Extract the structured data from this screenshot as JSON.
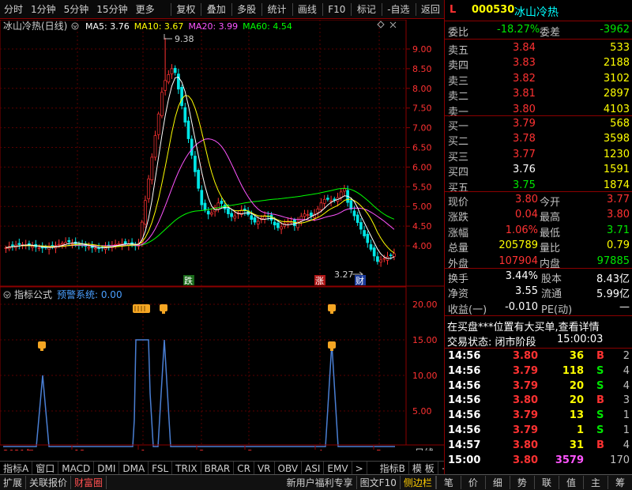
{
  "toolbar": {
    "left": [
      "分时",
      "1分钟",
      "5分钟",
      "15分钟",
      "更多"
    ],
    "right": [
      "复权",
      "叠加",
      "多股",
      "统计",
      "画线",
      "F10",
      "标记",
      "-自选",
      "返回"
    ]
  },
  "main_chart": {
    "title": "冰山冷热(日线)",
    "ma": [
      {
        "label": "MA5: 3.76",
        "color": "#ffffff"
      },
      {
        "label": "MA10: 3.67",
        "color": "#ffff00"
      },
      {
        "label": "MA20: 3.99",
        "color": "#ff55ff"
      },
      {
        "label": "MA60: 4.54",
        "color": "#00ff00"
      }
    ],
    "high_label": "9.38",
    "low_label": "3.27",
    "markers": [
      "跌",
      "涨",
      "财"
    ],
    "y_ticks": [
      "9.00",
      "8.50",
      "8.00",
      "7.50",
      "7.00",
      "6.50",
      "6.00",
      "5.50",
      "5.00",
      "4.50",
      "4.00"
    ]
  },
  "indicator_chart": {
    "title": "指标公式",
    "subtitle": "预警系统: 0.00",
    "y_ticks": [
      "20.00",
      "15.00",
      "10.00",
      "5.00"
    ]
  },
  "x_axis": {
    "labels": [
      "2021年",
      "12",
      "1",
      "2",
      "3",
      "4",
      "5"
    ],
    "period": "日线"
  },
  "bottom_tabs": [
    "指标A",
    "窗口",
    "MACD",
    "DMI",
    "DMA",
    "FSL",
    "TRIX",
    "BRAR",
    "CR",
    "VR",
    "OBV",
    "ASI",
    "EMV",
    ">",
    "指标B",
    "模 板",
    "+",
    "—"
  ],
  "stock": {
    "marker": "L",
    "code": "000530",
    "name": "冰山冷热"
  },
  "weibi": {
    "label1": "委比",
    "value1": "-18.27%",
    "label2": "委差",
    "value2": "-3962"
  },
  "asks": [
    {
      "label": "卖五",
      "price": "3.84",
      "vol": "533"
    },
    {
      "label": "卖四",
      "price": "3.83",
      "vol": "2188"
    },
    {
      "label": "卖三",
      "price": "3.82",
      "vol": "3102"
    },
    {
      "label": "卖二",
      "price": "3.81",
      "vol": "2897"
    },
    {
      "label": "卖一",
      "price": "3.80",
      "vol": "4103"
    }
  ],
  "bids": [
    {
      "label": "买一",
      "price": "3.79",
      "vol": "568",
      "pc": "red"
    },
    {
      "label": "买二",
      "price": "3.78",
      "vol": "3598",
      "pc": "red"
    },
    {
      "label": "买三",
      "price": "3.77",
      "vol": "1230",
      "pc": "red"
    },
    {
      "label": "买四",
      "price": "3.76",
      "vol": "1591",
      "pc": "white"
    },
    {
      "label": "买五",
      "price": "3.75",
      "vol": "1874",
      "pc": "green"
    }
  ],
  "quote": [
    {
      "l1": "现价",
      "v1": "3.80",
      "c1": "red",
      "l2": "今开",
      "v2": "3.77",
      "c2": "red"
    },
    {
      "l1": "涨跌",
      "v1": "0.04",
      "c1": "red",
      "l2": "最高",
      "v2": "3.80",
      "c2": "red"
    },
    {
      "l1": "涨幅",
      "v1": "1.06%",
      "c1": "red",
      "l2": "最低",
      "v2": "3.71",
      "c2": "green"
    },
    {
      "l1": "总量",
      "v1": "205789",
      "c1": "yellow",
      "l2": "量比",
      "v2": "0.79",
      "c2": "yellow"
    },
    {
      "l1": "外盘",
      "v1": "107904",
      "c1": "red",
      "l2": "内盘",
      "v2": "97885",
      "c2": "green"
    }
  ],
  "fin": [
    {
      "l1": "换手",
      "v1": "3.44%",
      "l2": "股本",
      "v2": "8.43亿"
    },
    {
      "l1": "净资",
      "v1": "3.55",
      "l2": "流通",
      "v2": "5.99亿"
    },
    {
      "l1": "收益(一)",
      "v1": "-0.010",
      "l2": "PE(动)",
      "v2": "—"
    }
  ],
  "notice": "在买盘***位置有大买单,查看详情",
  "trade_state": {
    "label": "交易状态: 闭市阶段",
    "time": "15:00:03"
  },
  "ticks": [
    {
      "t": "14:56",
      "p": "3.80",
      "pc": "red",
      "v": "36",
      "d": "B",
      "dc": "red",
      "n": "2"
    },
    {
      "t": "14:56",
      "p": "3.79",
      "pc": "red",
      "v": "118",
      "d": "S",
      "dc": "green",
      "n": "4"
    },
    {
      "t": "14:56",
      "p": "3.79",
      "pc": "red",
      "v": "20",
      "d": "S",
      "dc": "green",
      "n": "4"
    },
    {
      "t": "14:56",
      "p": "3.80",
      "pc": "red",
      "v": "20",
      "d": "B",
      "dc": "red",
      "n": "3"
    },
    {
      "t": "14:56",
      "p": "3.79",
      "pc": "red",
      "v": "13",
      "d": "S",
      "dc": "green",
      "n": "1"
    },
    {
      "t": "14:56",
      "p": "3.79",
      "pc": "red",
      "v": "1",
      "d": "S",
      "dc": "green",
      "n": "1"
    },
    {
      "t": "14:57",
      "p": "3.80",
      "pc": "red",
      "v": "31",
      "d": "B",
      "dc": "red",
      "n": "4"
    },
    {
      "t": "15:00",
      "p": "3.80",
      "pc": "red",
      "v": "3579",
      "d": "",
      "dc": "purple",
      "n": "170"
    }
  ],
  "status_left": [
    "扩展",
    "关联报价",
    "财富圈"
  ],
  "status_mid": [
    "新用户福利专享",
    "图文F10",
    "侧边栏"
  ],
  "status_right": [
    "笔",
    "价",
    "细",
    "势",
    "联",
    "值",
    "主",
    "筹"
  ],
  "colors": {
    "up": "#ff3232",
    "down": "#00e600",
    "border": "#8b0000",
    "indicator_line": "#4a7fd4"
  }
}
